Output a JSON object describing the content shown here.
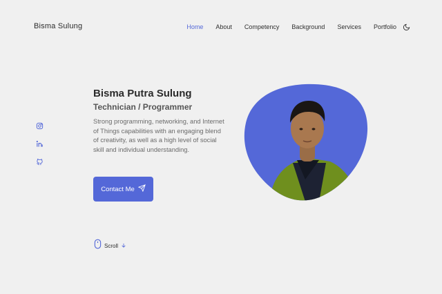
{
  "header": {
    "brand": "Bisma Sulung",
    "nav": [
      {
        "label": "Home",
        "active": true
      },
      {
        "label": "About",
        "active": false
      },
      {
        "label": "Competency",
        "active": false
      },
      {
        "label": "Background",
        "active": false
      },
      {
        "label": "Services",
        "active": false
      },
      {
        "label": "Portfolio",
        "active": false
      }
    ],
    "theme_icon": "moon-icon"
  },
  "socials": [
    {
      "icon": "instagram-icon"
    },
    {
      "icon": "linkedin-icon"
    },
    {
      "icon": "github-icon"
    }
  ],
  "hero": {
    "name": "Bisma Putra Sulung",
    "role": "Technician / Programmer",
    "description": "Strong programming, networking, and Internet of Things capabilities with an engaging blend of creativity, as well as a high level of social skill and individual understanding.",
    "cta_label": "Contact Me",
    "cta_icon": "send-icon",
    "photo_icon": "profile-photo"
  },
  "scroll": {
    "label": "Scroll",
    "mouse_icon": "mouse-icon",
    "arrow_icon": "arrow-down-icon"
  },
  "colors": {
    "accent": "#5468d8",
    "background": "#f0f0f0",
    "text": "#2b2b2b",
    "jacket": "#6f8f1e"
  }
}
